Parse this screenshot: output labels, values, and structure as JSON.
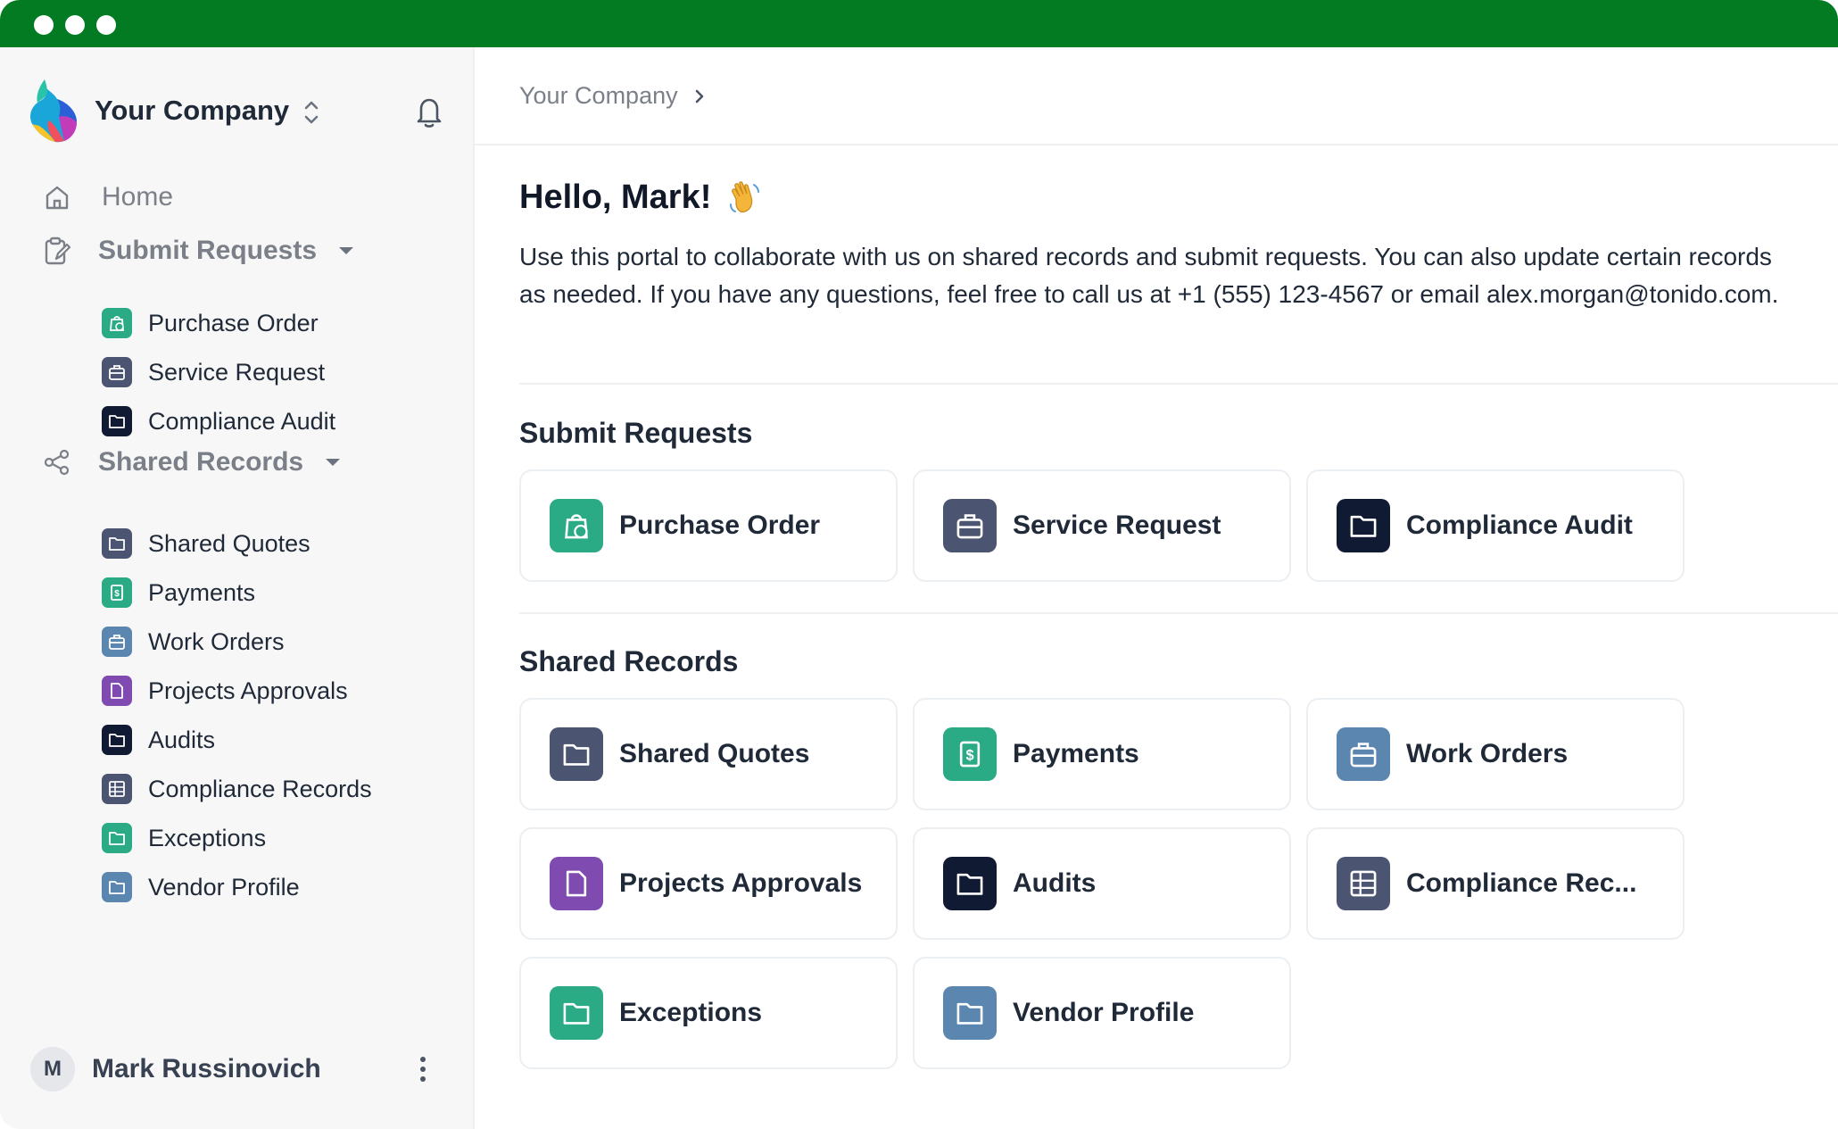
{
  "window": {
    "titlebar_color": "#037b22"
  },
  "sidebar": {
    "company": "Your Company",
    "nav": {
      "home": "Home",
      "submit_requests": "Submit Requests",
      "shared_records": "Shared Records"
    },
    "submit_items": [
      {
        "label": "Purchase Order",
        "icon": "shopping-bag-dollar-icon",
        "color": "#2baa86"
      },
      {
        "label": "Service Request",
        "icon": "toolbox-icon",
        "color": "#4b5470"
      },
      {
        "label": "Compliance Audit",
        "icon": "folder-icon",
        "color": "#111a33"
      }
    ],
    "shared_items": [
      {
        "label": "Shared Quotes",
        "icon": "folder-icon",
        "color": "#4b5470"
      },
      {
        "label": "Payments",
        "icon": "dollar-document-icon",
        "color": "#2baa86"
      },
      {
        "label": "Work Orders",
        "icon": "toolbox-icon",
        "color": "#5a86b0"
      },
      {
        "label": "Projects Approvals",
        "icon": "document-icon",
        "color": "#7f4bb0"
      },
      {
        "label": "Audits",
        "icon": "folder-icon",
        "color": "#111a33"
      },
      {
        "label": "Compliance Records",
        "icon": "table-icon",
        "color": "#4b5470"
      },
      {
        "label": "Exceptions",
        "icon": "folder-icon",
        "color": "#2baa86"
      },
      {
        "label": "Vendor Profile",
        "icon": "folder-icon",
        "color": "#5a86b0"
      }
    ],
    "user": {
      "initial": "M",
      "name": "Mark Russinovich"
    }
  },
  "main": {
    "breadcrumb": "Your Company",
    "greeting": "Hello, Mark!",
    "intro": "Use this portal to collaborate with us on shared records and submit requests. You can also update certain records as needed. If you have any questions, feel free to call us at +1 (555) 123-4567 or email alex.morgan@tonido.com.",
    "submit_title": "Submit Requests",
    "shared_title": "Shared Records",
    "submit_cards": [
      {
        "label": "Purchase Order"
      },
      {
        "label": "Service Request"
      },
      {
        "label": "Compliance Audit"
      }
    ],
    "shared_cards": [
      {
        "label": "Shared Quotes"
      },
      {
        "label": "Payments"
      },
      {
        "label": "Work Orders"
      },
      {
        "label": "Projects Approvals"
      },
      {
        "label": "Audits"
      },
      {
        "label": "Compliance Rec..."
      },
      {
        "label": "Exceptions"
      },
      {
        "label": "Vendor Profile"
      }
    ]
  }
}
